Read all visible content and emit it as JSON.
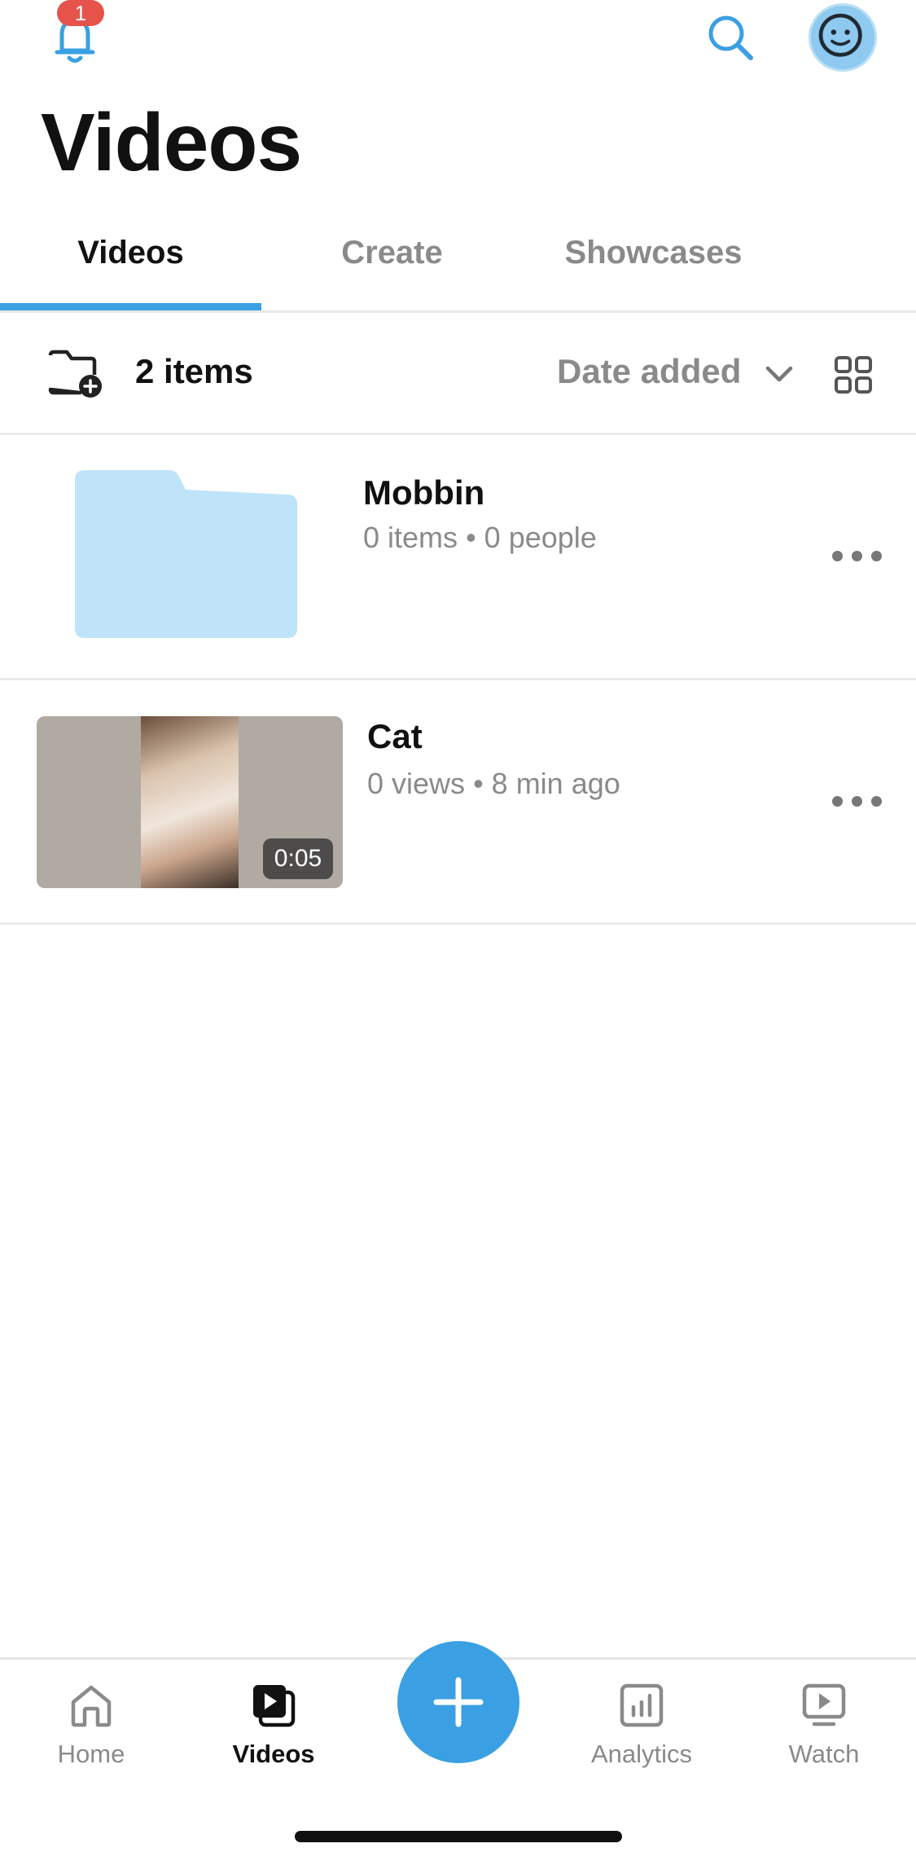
{
  "header": {
    "notification_count": "1",
    "title": "Videos",
    "icons": {
      "notifications": "bell-icon",
      "search": "search-icon",
      "profile": "avatar-icon"
    }
  },
  "tabs": [
    {
      "label": "Videos",
      "active": true
    },
    {
      "label": "Create",
      "active": false
    },
    {
      "label": "Showcases",
      "active": false
    }
  ],
  "toolbar": {
    "item_count": "2 items",
    "sort_label": "Date added",
    "icons": {
      "new_folder": "folder-add-icon",
      "sort": "chevron-down-icon",
      "view": "grid-view-icon"
    }
  },
  "items": [
    {
      "type": "folder",
      "title": "Mobbin",
      "meta_left": "0 items",
      "meta_right": "0 people"
    },
    {
      "type": "video",
      "title": "Cat",
      "meta_left": "0 views",
      "meta_right": "8 min ago",
      "duration": "0:05"
    }
  ],
  "bottom_nav": [
    {
      "label": "Home",
      "icon": "home-icon",
      "active": false
    },
    {
      "label": "Videos",
      "icon": "videos-icon",
      "active": true
    },
    {
      "label": "Analytics",
      "icon": "analytics-icon",
      "active": false
    },
    {
      "label": "Watch",
      "icon": "watch-icon",
      "active": false
    }
  ],
  "colors": {
    "accent": "#3aa0e3",
    "badge": "#e5534b",
    "folder": "#bfe3f8",
    "muted_text": "#8a8a8a"
  }
}
